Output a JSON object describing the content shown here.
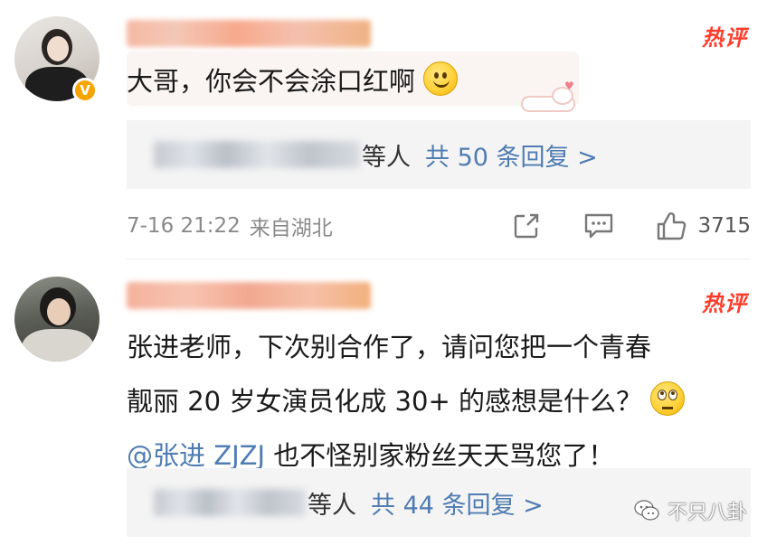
{
  "comments": [
    {
      "hot_label": "热评",
      "text": "大哥，你会不会涂口红啊",
      "emoji": "smile-emoji",
      "reply_suffix": "等人",
      "reply_count_text": "共 50 条回复 >",
      "time": "7-16 21:22",
      "source": "来自湖北",
      "likes": "3715",
      "verified_mark": "V"
    },
    {
      "hot_label": "热评",
      "line1": "张进老师，下次别合作了，请问您把一个青春",
      "line2": "靓丽 20 岁女演员化成 30+ 的感想是什么？",
      "line3_mention": "@张进 ZJZJ",
      "line3_rest": " 也不怪别家粉丝天天骂您了！",
      "emoji": "eye-roll-emoji",
      "reply_suffix": "等人",
      "reply_count_text": "共 44 条回复 >"
    }
  ],
  "icons": {
    "share": "share-icon",
    "comment": "comment-icon",
    "like": "thumbs-up-icon",
    "watermark": "wechat-icon"
  },
  "watermark": {
    "text": "不只八卦"
  },
  "colors": {
    "hot": "#ff3d2c",
    "link": "#4f7cb3",
    "reply_bg": "#f4f4f4",
    "meta_text": "#8a8a8a"
  }
}
